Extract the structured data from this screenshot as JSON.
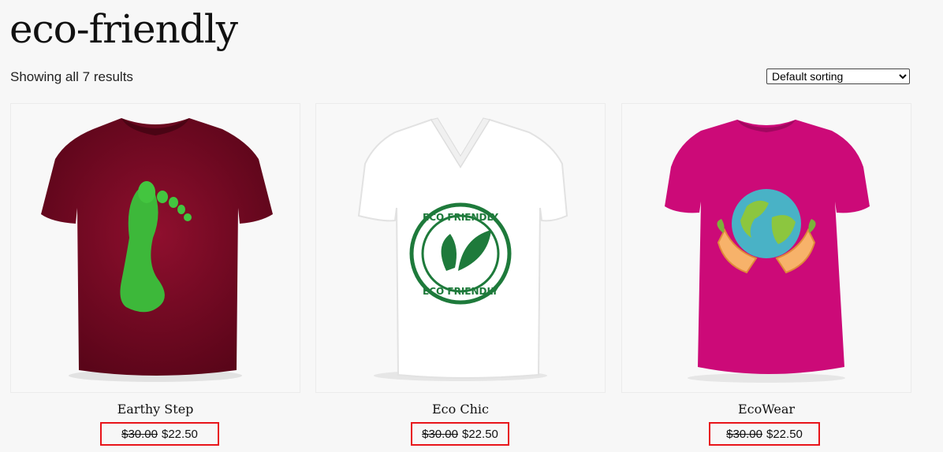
{
  "page": {
    "title": "eco-friendly"
  },
  "toolbar": {
    "result_count": "Showing all 7 results",
    "sort_selected": "Default sorting"
  },
  "products": [
    {
      "name": "Earthy Step",
      "old_price": "$30.00",
      "price": "$22.50",
      "shirt_color": "#7d0a26",
      "graphic": "green-footprint"
    },
    {
      "name": "Eco Chic",
      "old_price": "$30.00",
      "price": "$22.50",
      "shirt_color": "#ffffff",
      "graphic": "eco-friendly-stamp",
      "stamp_text": "ECO FRIENDLY"
    },
    {
      "name": "EcoWear",
      "old_price": "$30.00",
      "price": "$22.50",
      "shirt_color": "#cc0a78",
      "graphic": "earth-in-hands"
    }
  ],
  "colors": {
    "price_highlight": "#e8141a",
    "stamp_green": "#1e7a3b"
  }
}
